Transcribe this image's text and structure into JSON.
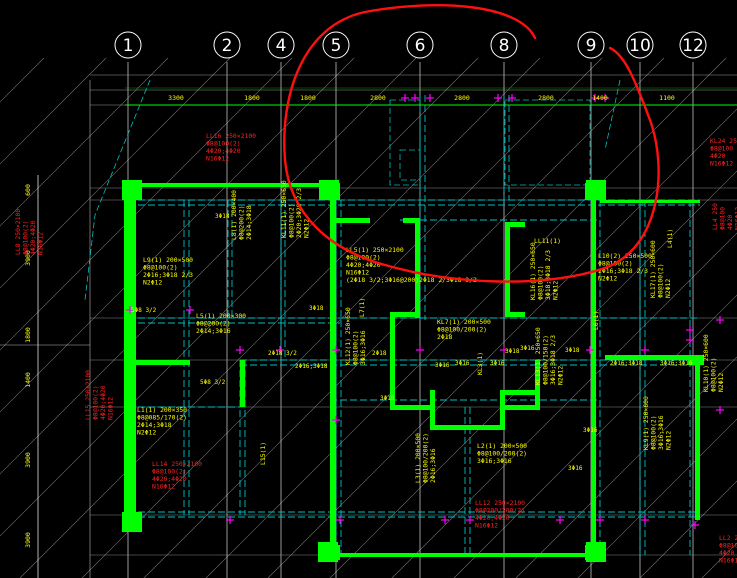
{
  "grid_axes": [
    "1",
    "2",
    "4",
    "5",
    "6",
    "8",
    "9",
    "10",
    "12"
  ],
  "dimensions_top": [
    "3300",
    "1800",
    "1800",
    "2800",
    "2800",
    "2800",
    "1400",
    "1100"
  ],
  "dimensions_left": [
    "600",
    "3900",
    "1800",
    "1400",
    "3900",
    "3900"
  ],
  "labels": {
    "ll16": [
      "LL16 250×2100",
      "Φ8@100(2)",
      "4Φ20;4Φ20",
      "N16Φ12"
    ],
    "ll8": [
      "LL8 250×2100",
      "Φ8@100(2)",
      "4Φ20;4Φ20",
      "N16Φ12"
    ],
    "l9": [
      "L9(1) 200×500",
      "Φ8@100(2)",
      "2Φ16;3Φ18 2/3",
      "N2Φ12"
    ],
    "l8": [
      "L8(1) 200×400",
      "Φ8@200(2)",
      "2Φ14;3Φ18"
    ],
    "kl11": [
      "KL11(1) 250×650",
      "Φ8@100(2)",
      "2Φ20;3Φ20 2/3",
      "N2Φ12"
    ],
    "ll5": [
      "LL5(1) 250×2100",
      "Φ8@100(2)",
      "4Φ20;4Φ20",
      "N16Φ12",
      "(2Φ18 3/2;3Φ16@200)2Φ18 2/3Φ18 3/2"
    ],
    "ll11": [
      "LL11(1)"
    ],
    "l10": [
      "L10(2) 250×500",
      "Φ8@100(2)",
      "2Φ16;3Φ18 2/3",
      "N2Φ12"
    ],
    "l4": [
      "L4(1)"
    ],
    "kl7": [
      "KL7(1) 200×500",
      "Φ8@100/200(2)",
      "2Φ18"
    ],
    "kl16": [
      "KL16(1) 250×650",
      "Φ8@100(2)",
      "3Φ18;3Φ18 2/3",
      "N2Φ12"
    ],
    "l5": [
      "L5(1) 200×300",
      "Φ8@200(2)",
      "2Φ14;3Φ16"
    ],
    "l1": [
      "L1(1) 200×350",
      "Φ8@085/170(2)",
      "2Φ14;3Φ18",
      "N2Φ12"
    ],
    "ll14": [
      "LL14 250×2100",
      "Φ8@100(2)",
      "4Φ20;4Φ20",
      "N16Φ12"
    ],
    "kl12": [
      "KL12(1) 250×650",
      "Φ8@100(2)",
      "3Φ16;3Φ16"
    ],
    "kl13": [
      "KL13(1) 250×650",
      "Φ8@100/150(2)",
      "3Φ16;3Φ18 2/3",
      "N2Φ12"
    ],
    "l2": [
      "L2(1) 200×500",
      "Φ8@100/200(2)",
      "3Φ16;3Φ16"
    ],
    "l3": [
      "L3(1) 200×500",
      "Φ8@100/200(2)",
      "2Φ16;3Φ16"
    ],
    "ll12": [
      "LL12 250×2100",
      "Φ8@200/200(2)",
      "4Φ20;4Φ20",
      "N16Φ12"
    ],
    "kl9": [
      "KL9(1) 250×600",
      "Φ8@100(2)",
      "3Φ16;3Φ16",
      "N2Φ12"
    ],
    "kl10": [
      "KL10(1) 250×600",
      "Φ8@100(2)",
      "N2Φ12"
    ],
    "kl17": [
      "KL17(1) 250×600",
      "Φ8@100(2)",
      "N2Φ12"
    ],
    "kl24": [
      "KL24 250",
      "Φ8@100",
      "4Φ20",
      "N16Φ12"
    ],
    "l15": [
      "L15(1)"
    ],
    "l7": [
      "L7(1)"
    ],
    "kl3": [
      "KL3(1)"
    ],
    "l6": [
      "L6(1)"
    ],
    "llx": [
      "LL2 250",
      "Φ8@100",
      "4Φ20",
      "N16Φ12"
    ],
    "ll15": [
      "LL15 250×2100",
      "Φ8@100(2)",
      "4Φ20;4Φ20",
      "N16Φ12"
    ],
    "llb": [
      "LL4 250",
      "Φ8@100",
      "4Φ20",
      "N16Φ12"
    ]
  },
  "annotations": [
    "5Φ8 3/2",
    "3Φ18",
    "3Φ18",
    "2Φ18",
    "2Φ18 3/2",
    "3Φ16",
    "3Φ18",
    "3Φ18",
    "5Φ8 3/2",
    "2Φ16;3Φ18",
    "2Φ16;3Φ18",
    "3Φ16;3Φ16",
    "3Φ16",
    "3Φ16",
    "3Φ16",
    "3Φ18",
    "3Φ16",
    "3Φ16"
  ],
  "colors": {
    "background": "#000000",
    "wall_walls": "#00ff00",
    "beam_lines": "#00c0c0",
    "grid_lines": "#ffffff",
    "annotation_yellow": "#ffff00",
    "annotation_red": "#ff2020",
    "annotation_cyan": "#00ffff",
    "markup_circle": "#ff1010",
    "magenta": "#ff00ff"
  }
}
